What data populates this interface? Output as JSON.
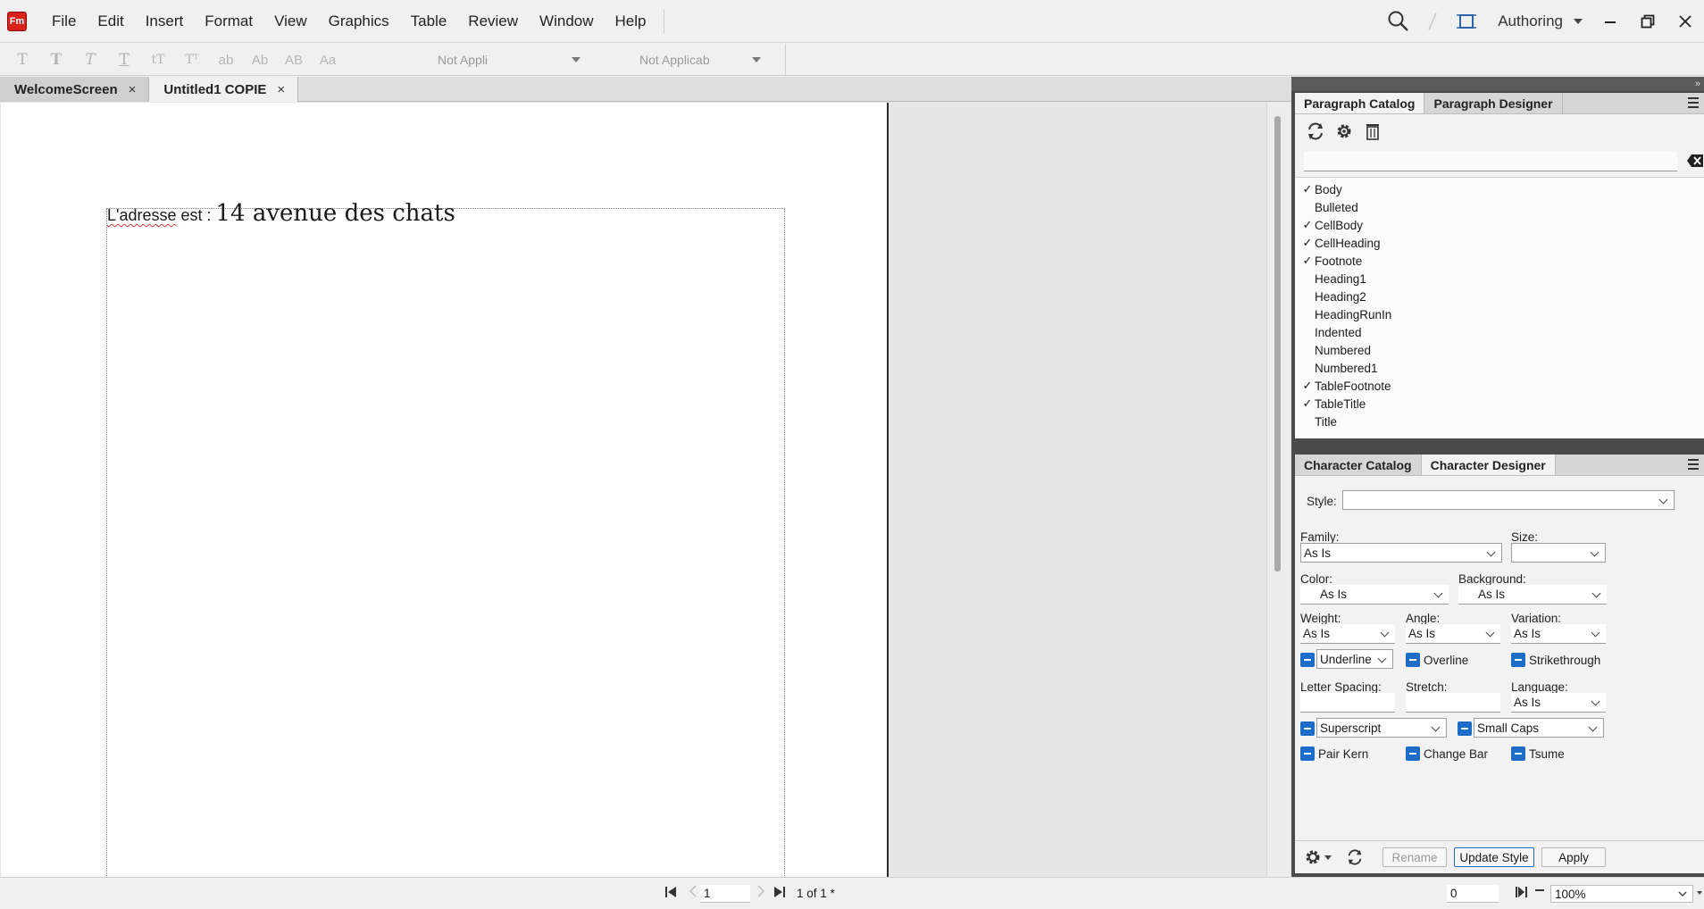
{
  "app": {
    "logo_text": "Fm"
  },
  "menu": [
    "File",
    "Edit",
    "Insert",
    "Format",
    "View",
    "Graphics",
    "Table",
    "Review",
    "Window",
    "Help"
  ],
  "workspace": {
    "label": "Authoring"
  },
  "toolbar": {
    "glyphs": [
      "T",
      "T",
      "T",
      "T",
      "tT",
      "Tᵀ",
      "ab",
      "Ab",
      "AB",
      "Aa"
    ],
    "select1": "Not Appli",
    "select2": "Not Applicab"
  },
  "doc_tabs": [
    {
      "label": "WelcomeScreen",
      "close": "×"
    },
    {
      "label": "Untitled1 COPIE",
      "close": "×"
    }
  ],
  "document": {
    "part_a": "L'adresse",
    "part_b": " est : ",
    "part_c": "14 avenue des chats"
  },
  "paragraph_panel": {
    "tabs": [
      "Paragraph Catalog",
      "Paragraph Designer"
    ],
    "search_value": "",
    "items": [
      {
        "name": "Body",
        "check": "✓"
      },
      {
        "name": "Bulleted",
        "check": ""
      },
      {
        "name": "CellBody",
        "check": "✓"
      },
      {
        "name": "CellHeading",
        "check": "✓"
      },
      {
        "name": "Footnote",
        "check": "✓"
      },
      {
        "name": "Heading1",
        "check": ""
      },
      {
        "name": "Heading2",
        "check": ""
      },
      {
        "name": "HeadingRunIn",
        "check": ""
      },
      {
        "name": "Indented",
        "check": ""
      },
      {
        "name": "Numbered",
        "check": ""
      },
      {
        "name": "Numbered1",
        "check": ""
      },
      {
        "name": "TableFootnote",
        "check": "✓"
      },
      {
        "name": "TableTitle",
        "check": "✓"
      },
      {
        "name": "Title",
        "check": ""
      }
    ]
  },
  "character_panel": {
    "tabs": [
      "Character Catalog",
      "Character Designer"
    ],
    "style_label": "Style:",
    "style_value": "",
    "family_label": "Family:",
    "family_value": "As Is",
    "size_label": "Size:",
    "size_value": "",
    "color_label": "Color:",
    "color_value": "As Is",
    "background_label": "Background:",
    "background_value": "As Is",
    "weight_label": "Weight:",
    "weight_value": "As Is",
    "angle_label": "Angle:",
    "angle_value": "As Is",
    "variation_label": "Variation:",
    "variation_value": "As Is",
    "underline_value": "Underline",
    "overline_label": "Overline",
    "strikethrough_label": "Strikethrough",
    "letter_spacing_label": "Letter Spacing:",
    "letter_spacing_value": "",
    "stretch_label": "Stretch:",
    "stretch_value": "",
    "language_label": "Language:",
    "language_value": "As Is",
    "superscript_value": "Superscript",
    "small_caps_value": "Small Caps",
    "pair_kern_label": "Pair Kern",
    "change_bar_label": "Change Bar",
    "tsume_label": "Tsume",
    "rename_label": "Rename",
    "update_style_label": "Update Style",
    "apply_label": "Apply"
  },
  "statusbar": {
    "page_value": "1",
    "page_of": "1 of 1 *",
    "coord_value": "0",
    "zoom_value": "100%"
  },
  "colors": {
    "accent": "#1e6ec8",
    "logo": "#d9211b",
    "spell_underline": "#d83b3b"
  }
}
